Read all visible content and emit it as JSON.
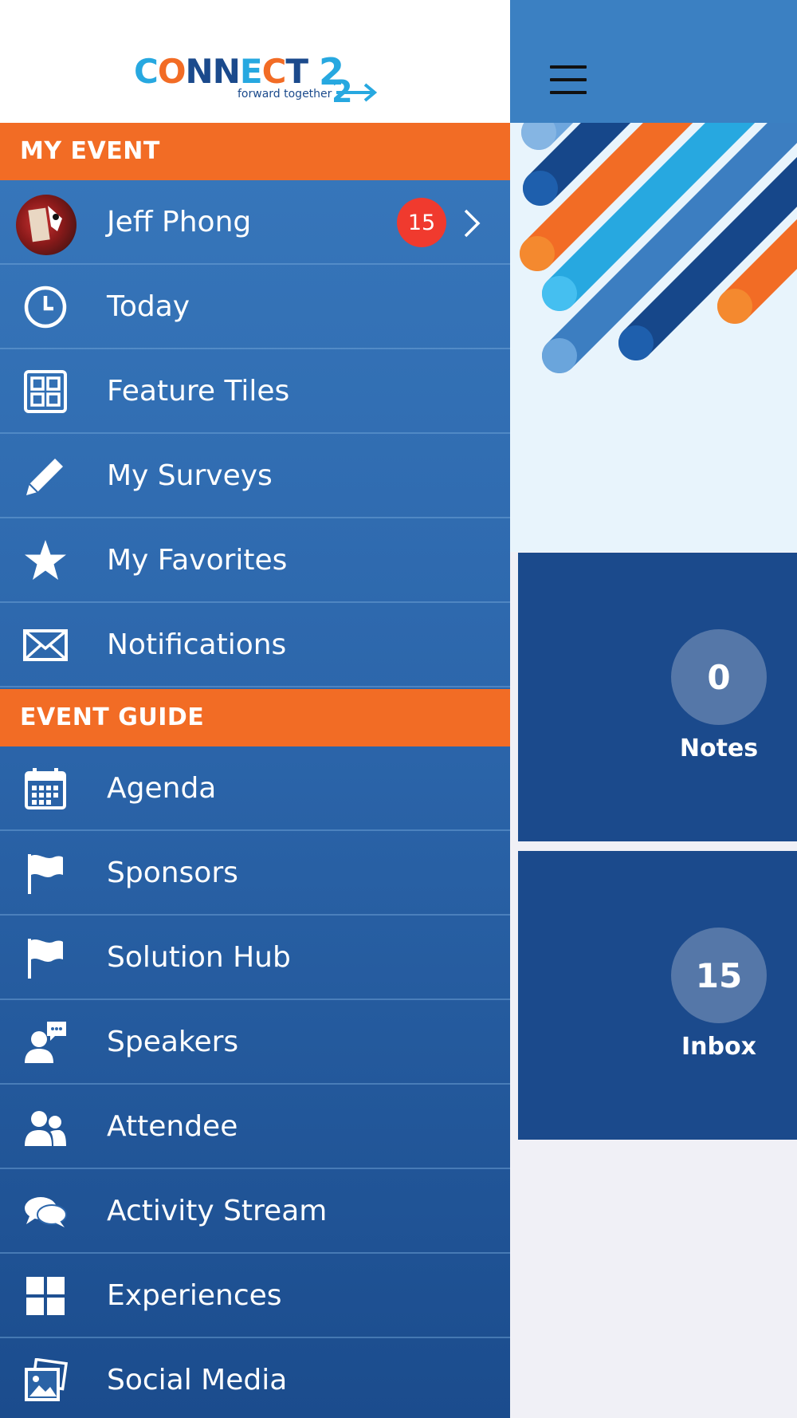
{
  "logo": {
    "text": "CONNECT 22",
    "tagline": "forward together"
  },
  "sections": {
    "my_event": "MY EVENT",
    "event_guide": "EVENT GUIDE"
  },
  "profile": {
    "name": "Jeff Phong",
    "badge": "15"
  },
  "my_event_items": [
    {
      "label": "Today",
      "icon": "clock-icon"
    },
    {
      "label": "Feature Tiles",
      "icon": "grid-tiles-icon"
    },
    {
      "label": "My Surveys",
      "icon": "pencil-icon"
    },
    {
      "label": "My Favorites",
      "icon": "star-icon"
    },
    {
      "label": "Notifications",
      "icon": "envelope-icon"
    }
  ],
  "event_guide_items": [
    {
      "label": "Agenda",
      "icon": "calendar-icon"
    },
    {
      "label": "Sponsors",
      "icon": "flag-icon"
    },
    {
      "label": "Solution Hub",
      "icon": "flag-icon"
    },
    {
      "label": "Speakers",
      "icon": "speaker-icon"
    },
    {
      "label": "Attendee",
      "icon": "people-icon"
    },
    {
      "label": "Activity Stream",
      "icon": "chat-bubbles-icon"
    },
    {
      "label": "Experiences",
      "icon": "windows-icon"
    },
    {
      "label": "Social Media",
      "icon": "photos-icon"
    }
  ],
  "tiles": {
    "notes": {
      "count": "0",
      "label": "Notes"
    },
    "inbox": {
      "count": "15",
      "label": "Inbox"
    }
  },
  "colors": {
    "drawer_top": "#3a7bbf",
    "drawer_bottom": "#1b4c8d",
    "section_header": "#f26c25",
    "badge": "#f03a2e",
    "tile": "#1b4a8c",
    "topbar": "#3b80c2"
  }
}
